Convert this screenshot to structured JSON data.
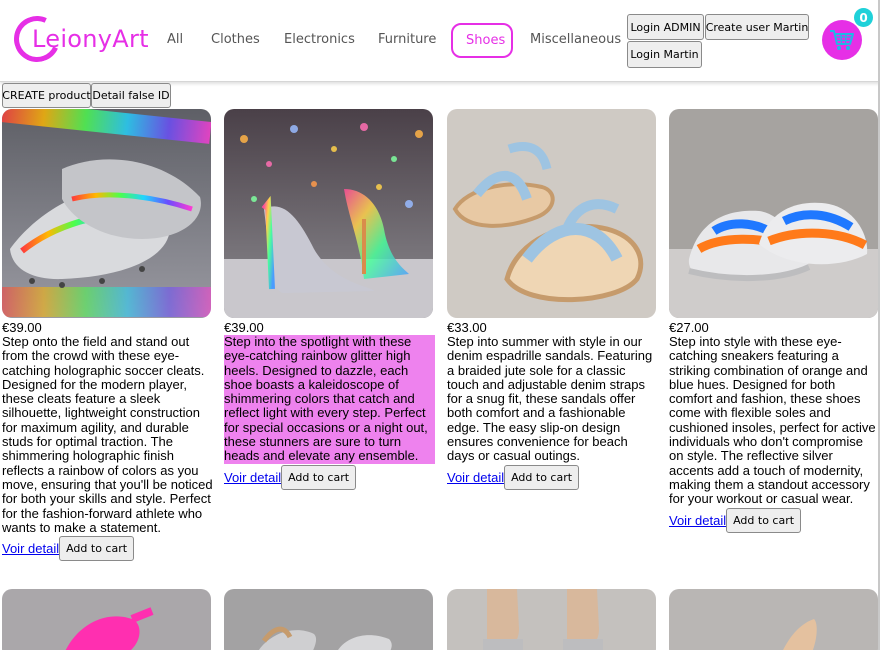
{
  "brand": {
    "name": "LeionyArt"
  },
  "nav": {
    "items": [
      {
        "label": "All"
      },
      {
        "label": "Clothes"
      },
      {
        "label": "Electronics"
      },
      {
        "label": "Furniture"
      },
      {
        "label": "Shoes",
        "active": true
      },
      {
        "label": "Miscellaneous"
      }
    ]
  },
  "auth": {
    "login_admin": "Login ADMIN",
    "create_user": "Create user Martin",
    "login_martin": "Login Martin"
  },
  "cart": {
    "count": "0",
    "icon": "shopping-cart-icon"
  },
  "toolbar": {
    "create_product": "CREATE product",
    "detail_false_id": "Detail false ID"
  },
  "products": [
    {
      "price": "€39.00",
      "description": "Step onto the field and stand out from the crowd with these eye-catching holographic soccer cleats. Designed for the modern player, these cleats feature a sleek silhouette, lightweight construction for maximum agility, and durable studs for optimal traction. The shimmering holographic finish reflects a rainbow of colors as you move, ensuring that you'll be noticed for both your skills and style. Perfect for the fashion-forward athlete who wants to make a statement.",
      "detail_label": "Voir detail",
      "add_label": "Add to cart"
    },
    {
      "price": "€39.00",
      "description": "Step into the spotlight with these eye-catching rainbow glitter high heels. Designed to dazzle, each shoe boasts a kaleidoscope of shimmering colors that catch and reflect light with every step. Perfect for special occasions or a night out, these stunners are sure to turn heads and elevate any ensemble.",
      "detail_label": "Voir detail",
      "add_label": "Add to cart"
    },
    {
      "price": "€33.00",
      "description": "Step into summer with style in our denim espadrille sandals. Featuring a braided jute sole for a classic touch and adjustable denim straps for a snug fit, these sandals offer both comfort and a fashionable edge. The easy slip-on design ensures convenience for beach days or casual outings.",
      "detail_label": "Voir detail",
      "add_label": "Add to cart"
    },
    {
      "price": "€27.00",
      "description": "Step into style with these eye-catching sneakers featuring a striking combination of orange and blue hues. Designed for both comfort and fashion, these shoes come with flexible soles and cushioned insoles, perfect for active individuals who don't compromise on style. The reflective silver accents add a touch of modernity, making them a standout accessory for your workout or casual wear.",
      "detail_label": "Voir detail",
      "add_label": "Add to cart"
    }
  ],
  "colors": {
    "accent": "#e62fe6",
    "badge": "#1fd1d9",
    "highlight": "#ee82ee",
    "link": "#0000ee"
  }
}
